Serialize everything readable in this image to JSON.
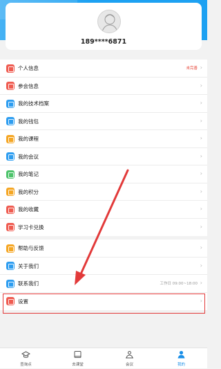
{
  "profile": {
    "phone": "189****6871"
  },
  "menu_group_1": [
    {
      "label": "个人信息",
      "aux": "未完善",
      "icon": "person-icon",
      "color": "#ef5b50"
    },
    {
      "label": "参会信息",
      "icon": "clipboard-icon",
      "color": "#ef5b50"
    },
    {
      "label": "我的技术档案",
      "icon": "file-icon",
      "color": "#2d9df0"
    },
    {
      "label": "我的钱包",
      "icon": "wallet-icon",
      "color": "#2d9df0"
    },
    {
      "label": "我的课程",
      "icon": "course-icon",
      "color": "#f5a623"
    },
    {
      "label": "我的会议",
      "icon": "meeting-icon",
      "color": "#2d9df0"
    },
    {
      "label": "我的笔记",
      "icon": "note-icon",
      "color": "#4cc36a"
    },
    {
      "label": "我的积分",
      "icon": "points-icon",
      "color": "#f5a623"
    },
    {
      "label": "我的收藏",
      "icon": "star-icon",
      "color": "#ef5b50"
    },
    {
      "label": "学习卡兑换",
      "icon": "card-icon",
      "color": "#ef5b50"
    }
  ],
  "menu_group_2": [
    {
      "label": "帮助与反馈",
      "icon": "help-icon",
      "color": "#f5a623"
    },
    {
      "label": "关于我们",
      "icon": "info-icon",
      "color": "#2d9df0"
    },
    {
      "label": "联系我们",
      "aux": "工作日 09:00~18:00",
      "icon": "phone-icon",
      "color": "#2d9df0"
    },
    {
      "label": "设置",
      "icon": "settings-icon",
      "color": "#ef5b50"
    }
  ],
  "tabs": [
    {
      "label": "查询点",
      "icon": "graduation-icon"
    },
    {
      "label": "去课堂",
      "icon": "book-icon"
    },
    {
      "label": "会议",
      "icon": "meeting-people-icon"
    },
    {
      "label": "我的",
      "icon": "user-icon",
      "active": true
    }
  ],
  "colors": {
    "header": "#1da1f2",
    "accent": "#1a8fe8",
    "highlight": "#e23a3a"
  }
}
